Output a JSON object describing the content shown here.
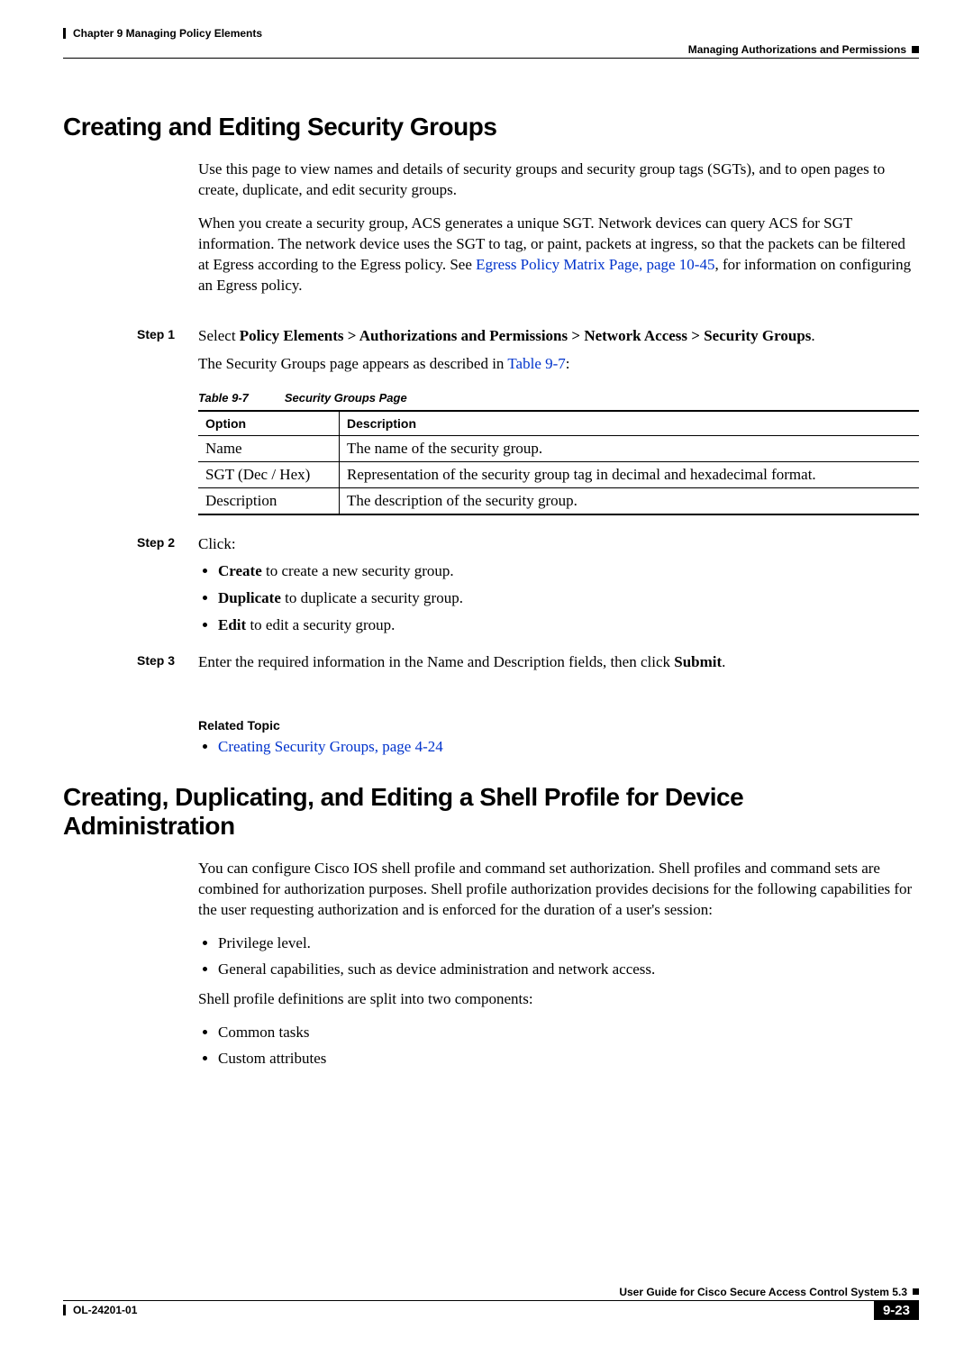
{
  "header": {
    "chapter": "Chapter 9      Managing Policy Elements",
    "section": "Managing Authorizations and Permissions"
  },
  "h1a": "Creating and Editing Security Groups",
  "intro1": "Use this page to view names and details of security groups and security group tags (SGTs), and to open pages to create, duplicate, and edit security groups.",
  "intro2a": "When you create a security group, ACS generates a unique SGT. Network devices can query ACS for SGT information. The network device uses the SGT to tag, or paint, packets at ingress, so that the packets can be filtered at Egress according to the Egress policy. See ",
  "intro2link": "Egress Policy Matrix Page, page 10-45",
  "intro2b": ", for information on configuring an Egress policy.",
  "steps": {
    "s1label": "Step 1",
    "s1a": "Select ",
    "s1path": "Policy Elements > Authorizations and Permissions > Network Access > Security Groups",
    "s1b": ".",
    "s1c": "The Security Groups page appears as described in ",
    "s1clink": "Table 9-7",
    "s1d": ":",
    "s2label": "Step 2",
    "s2text": "Click:",
    "s2b1a": "Create",
    "s2b1b": " to create a new security group.",
    "s2b2a": "Duplicate",
    "s2b2b": " to duplicate a security group.",
    "s2b3a": "Edit",
    "s2b3b": " to edit a security group.",
    "s3label": "Step 3",
    "s3a": "Enter the required information in the Name and Description fields, then click ",
    "s3b": "Submit",
    "s3c": "."
  },
  "table": {
    "caption_num": "Table 9-7",
    "caption_title": "Security Groups Page",
    "h1": "Option",
    "h2": "Description",
    "rows": [
      {
        "c1": "Name",
        "c2": "The name of the security group."
      },
      {
        "c1": "SGT (Dec / Hex)",
        "c2": "Representation of the security group tag in decimal and hexadecimal format."
      },
      {
        "c1": "Description",
        "c2": "The description of the security group."
      }
    ]
  },
  "related": {
    "heading": "Related Topic",
    "link": "Creating Security Groups, page 4-24"
  },
  "h1b": "Creating, Duplicating, and Editing a Shell Profile for Device Administration",
  "shell": {
    "p1": "You can configure Cisco IOS shell profile and command set authorization. Shell profiles and command sets are combined for authorization purposes. Shell profile authorization provides decisions for the following capabilities for the user requesting authorization and is enforced for the duration of a user's session:",
    "b1": "Privilege level.",
    "b2": "General capabilities, such as device administration and network access.",
    "p2": "Shell profile definitions are split into two components:",
    "b3": "Common tasks",
    "b4": "Custom attributes"
  },
  "footer": {
    "guide": "User Guide for Cisco Secure Access Control System 5.3",
    "doc": "OL-24201-01",
    "page": "9-23"
  }
}
